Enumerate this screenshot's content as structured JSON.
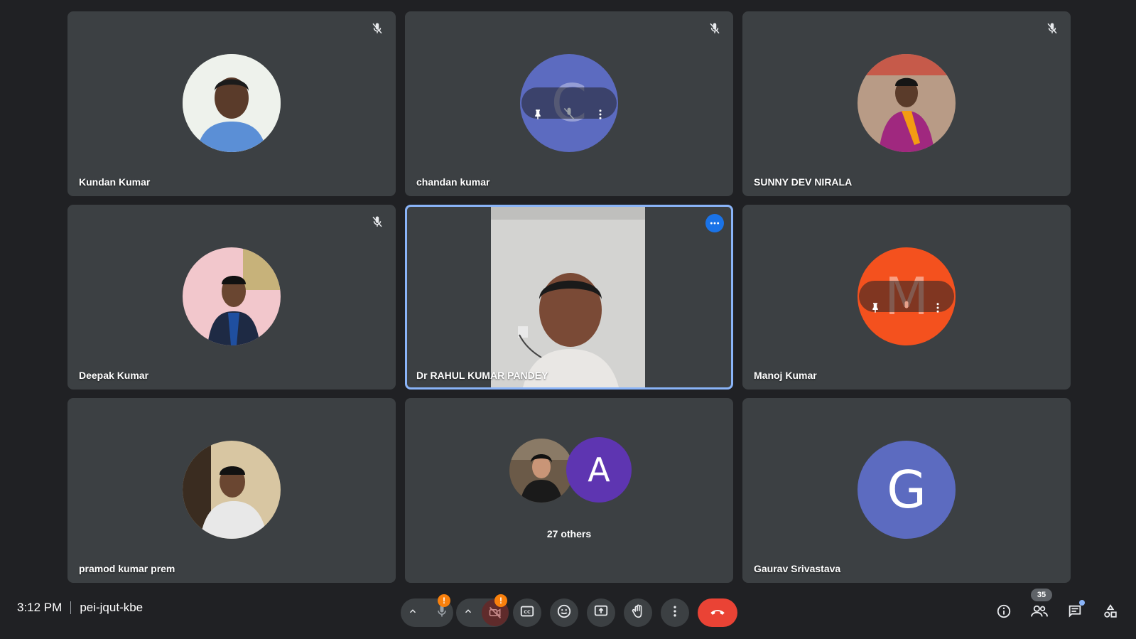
{
  "colors": {
    "background": "#202124",
    "tile": "#3c4043",
    "speaking_border": "#8ab4f8",
    "end_call": "#ea4335",
    "warning": "#f9800c",
    "avatar_chandan": "#5c6bc0",
    "avatar_manoj": "#f4511e",
    "avatar_gaurav": "#5c6bc0",
    "avatar_others": "#5e35b1"
  },
  "tiles": [
    {
      "name": "Kundan Kumar",
      "muted": true,
      "avatar": "photo"
    },
    {
      "name": "chandan kumar",
      "muted": true,
      "avatar_letter": "C"
    },
    {
      "name": "SUNNY DEV NIRALA",
      "muted": true,
      "avatar": "photo"
    },
    {
      "name": "Deepak Kumar",
      "muted": true,
      "avatar": "photo"
    },
    {
      "name": "Dr RAHUL KUMAR PANDEY",
      "speaking": true,
      "video": true
    },
    {
      "name": "Manoj Kumar",
      "avatar_letter": "M"
    },
    {
      "name": "pramod kumar prem",
      "avatar": "photo"
    },
    {
      "others_letter": "A",
      "others_label": "27 others"
    },
    {
      "name": "Gaurav Srivastava",
      "avatar_letter": "G"
    }
  ],
  "meeting": {
    "time": "3:12 PM",
    "code": "pei-jqut-kbe"
  },
  "controls": {
    "mic_warning": "!",
    "cam_warning": "!",
    "icons": [
      "chevron-up-icon",
      "microphone-icon",
      "camera-off-icon",
      "captions-icon",
      "emoji-icon",
      "present-screen-icon",
      "raise-hand-icon",
      "more-options-icon",
      "end-call-icon"
    ]
  },
  "right_panel": {
    "participant_count": "35",
    "icons": [
      "info-icon",
      "people-icon",
      "chat-icon",
      "activities-icon"
    ]
  }
}
